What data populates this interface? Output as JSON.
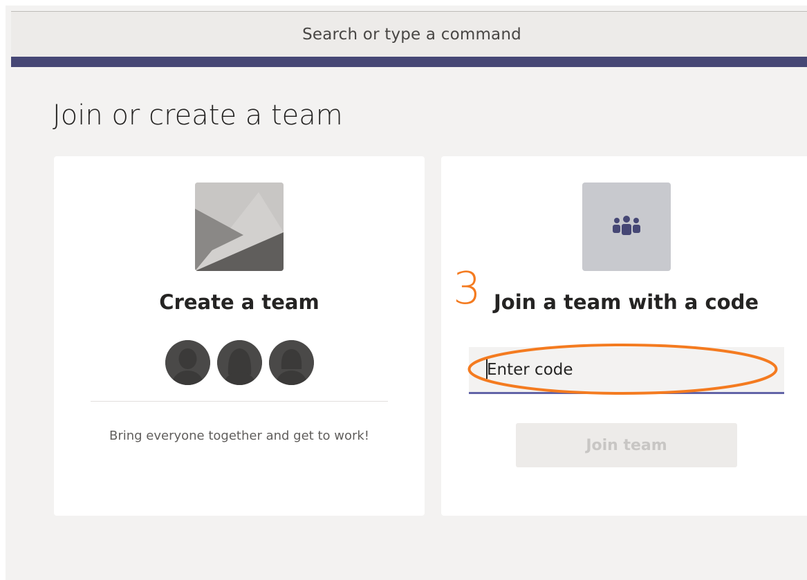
{
  "search": {
    "placeholder": "Search or type a command"
  },
  "page": {
    "title": "Join or create a team"
  },
  "create_card": {
    "title": "Create a team",
    "description": "Bring everyone together and get to work!"
  },
  "join_card": {
    "step_number": "3",
    "title": "Join a team with a code",
    "input_placeholder": "Enter code",
    "button_label": "Join team"
  },
  "colors": {
    "accent": "#464775",
    "annotation": "#f47b20",
    "input_underline": "#6264a7"
  },
  "icons": {
    "create_image": "landscape-placeholder-icon",
    "join_image": "people-group-icon",
    "avatar": "person-silhouette-icon"
  }
}
